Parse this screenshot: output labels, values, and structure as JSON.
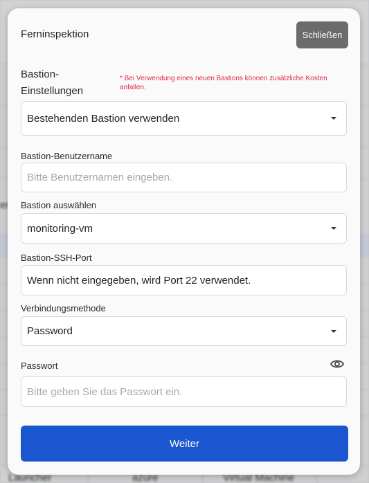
{
  "background": {
    "left_fragment": "er",
    "bottom_cells": [
      "Launcher",
      "azure",
      "Virtual Machine"
    ]
  },
  "modal": {
    "title": "Ferninspektion",
    "close_label": "Schließen"
  },
  "bastion_settings": {
    "label": "Bastion-Einstellungen",
    "label_line1": "Bastion-",
    "label_line2": "Einstellungen",
    "note": "* Bei Verwendung eines neuen Bastions können zusätzliche Kosten anfallen.",
    "selected": "Bestehenden Bastion verwenden"
  },
  "bastion_user": {
    "label": "Bastion-Benutzername",
    "placeholder": "Bitte Benutzernamen eingeben."
  },
  "bastion_select": {
    "label": "Bastion auswählen",
    "selected": "monitoring-vm"
  },
  "ssh_port": {
    "label": "Bastion-SSH-Port",
    "value": "Wenn nicht eingegeben, wird Port 22 verwendet."
  },
  "connection_method": {
    "label": "Verbindungsmethode",
    "selected": "Password"
  },
  "password": {
    "label": "Passwort",
    "placeholder": "Bitte geben Sie das Passwort ein.",
    "toggle_icon": "eye-icon"
  },
  "submit_label": "Weiter",
  "colors": {
    "primary": "#1a56d0",
    "close_button": "#6b6b6b",
    "note": "#e0284a"
  }
}
